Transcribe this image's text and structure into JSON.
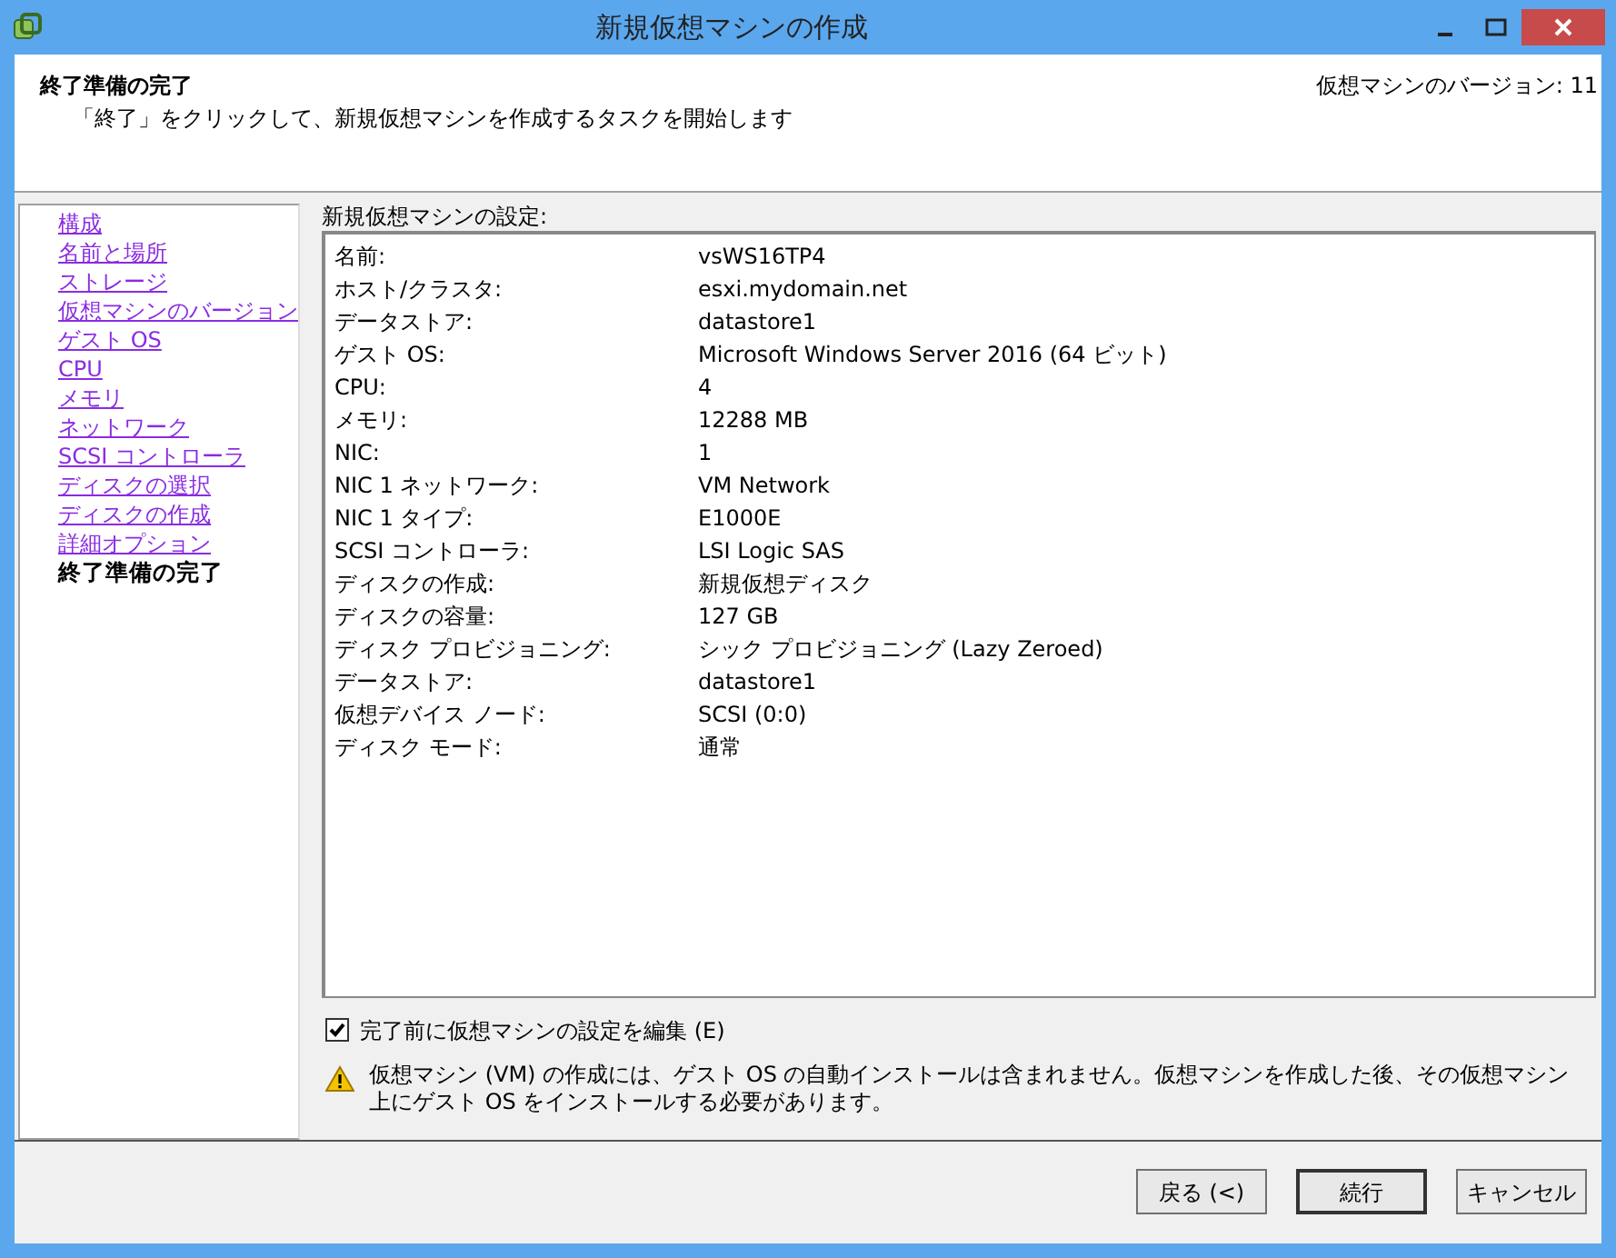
{
  "window": {
    "title": "新規仮想マシンの作成"
  },
  "header": {
    "title": "終了準備の完了",
    "subtitle": "「終了」をクリックして、新規仮想マシンを作成するタスクを開始します",
    "version": "仮想マシンのバージョン: 11"
  },
  "steps": [
    {
      "label": "構成",
      "selected": false
    },
    {
      "label": "名前と場所",
      "selected": false
    },
    {
      "label": "ストレージ",
      "selected": false
    },
    {
      "label": "仮想マシンのバージョン",
      "selected": false
    },
    {
      "label": "ゲスト OS",
      "selected": false
    },
    {
      "label": "CPU",
      "selected": false
    },
    {
      "label": "メモリ",
      "selected": false
    },
    {
      "label": "ネットワーク",
      "selected": false
    },
    {
      "label": "SCSI コントローラ",
      "selected": false
    },
    {
      "label": "ディスクの選択",
      "selected": false
    },
    {
      "label": "ディスクの作成",
      "selected": false
    },
    {
      "label": "詳細オプション",
      "selected": false
    },
    {
      "label": "終了準備の完了",
      "selected": true
    }
  ],
  "settings": {
    "title": "新規仮想マシンの設定:",
    "rows": [
      {
        "key": "名前:",
        "value": "vsWS16TP4"
      },
      {
        "key": "ホスト/クラスタ:",
        "value": "esxi.mydomain.net"
      },
      {
        "key": "データストア:",
        "value": "datastore1"
      },
      {
        "key": "ゲスト OS:",
        "value": "Microsoft Windows Server 2016 (64 ビット)"
      },
      {
        "key": "CPU:",
        "value": "4"
      },
      {
        "key": "メモリ:",
        "value": "12288 MB"
      },
      {
        "key": "NIC:",
        "value": "1"
      },
      {
        "key": "NIC 1 ネットワーク:",
        "value": "VM Network"
      },
      {
        "key": "NIC 1 タイプ:",
        "value": "E1000E"
      },
      {
        "key": "SCSI コントローラ:",
        "value": "LSI Logic SAS"
      },
      {
        "key": "ディスクの作成:",
        "value": "新規仮想ディスク"
      },
      {
        "key": "ディスクの容量:",
        "value": "127 GB"
      },
      {
        "key": "ディスク プロビジョニング:",
        "value": "シック プロビジョニング (Lazy Zeroed)"
      },
      {
        "key": "データストア:",
        "value": "datastore1"
      },
      {
        "key": "仮想デバイス ノード:",
        "value": "SCSI (0:0)"
      },
      {
        "key": "ディスク モード:",
        "value": "通常"
      }
    ]
  },
  "edit_checkbox": {
    "label": "完了前に仮想マシンの設定を編集 (E)",
    "checked": true
  },
  "warning": "仮想マシン (VM) の作成には、ゲスト OS の自動インストールは含まれません。仮想マシンを作成した後、その仮想マシン上にゲスト OS をインストールする必要があります。",
  "buttons": [
    {
      "label": "戻る (<)",
      "kind": "normal"
    },
    {
      "label": "続行",
      "kind": "default"
    },
    {
      "label": "キャンセル",
      "kind": "normal"
    }
  ]
}
